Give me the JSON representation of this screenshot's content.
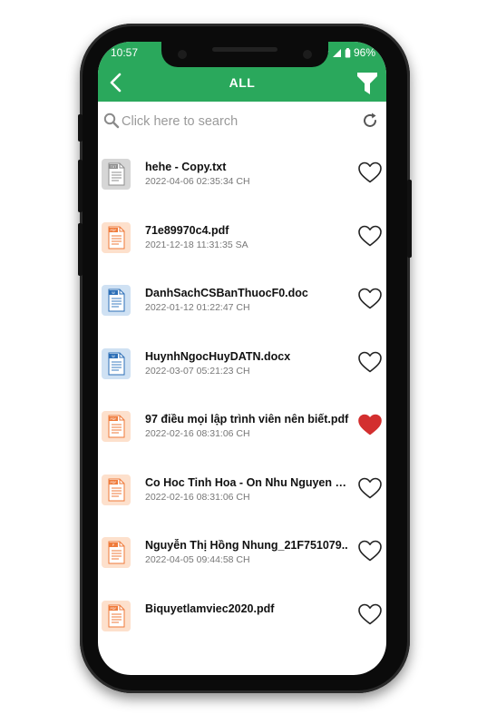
{
  "status": {
    "time": "10:57",
    "battery": "96%"
  },
  "header": {
    "title": "ALL",
    "back_icon": "chevron-left-icon",
    "filter_icon": "funnel-icon",
    "color": "#2aa85c"
  },
  "search": {
    "placeholder": "Click here to search",
    "value": "",
    "refresh_icon": "refresh-icon"
  },
  "files": [
    {
      "name": "hehe - Copy.txt",
      "date": "2022-04-06 02:35:34 CH",
      "type": "TXT",
      "favorite": false
    },
    {
      "name": "71e89970c4.pdf",
      "date": "2021-12-18 11:31:35 SA",
      "type": "PDF",
      "favorite": false
    },
    {
      "name": "DanhSachCSBanThuocF0.doc",
      "date": "2022-01-12 01:22:47 CH",
      "type": "W",
      "favorite": false
    },
    {
      "name": "HuynhNgocHuyDATN.docx",
      "date": "2022-03-07 05:21:23 CH",
      "type": "W",
      "favorite": false
    },
    {
      "name": "97 điều mọi lập trình viên nên biết.pdf",
      "date": "2022-02-16 08:31:06 CH",
      "type": "PDF",
      "favorite": true
    },
    {
      "name": "Co Hoc Tinh Hoa - On Nhu Nguyen Va..",
      "date": "2022-02-16 08:31:06 CH",
      "type": "PDF",
      "favorite": false
    },
    {
      "name": "Nguyễn Thị Hồng Nhung_21F751079..",
      "date": "2022-04-05 09:44:58 CH",
      "type": "P",
      "favorite": false
    },
    {
      "name": "Biquyetlamviec2020.pdf",
      "date": "",
      "type": "PDF",
      "favorite": false
    }
  ]
}
